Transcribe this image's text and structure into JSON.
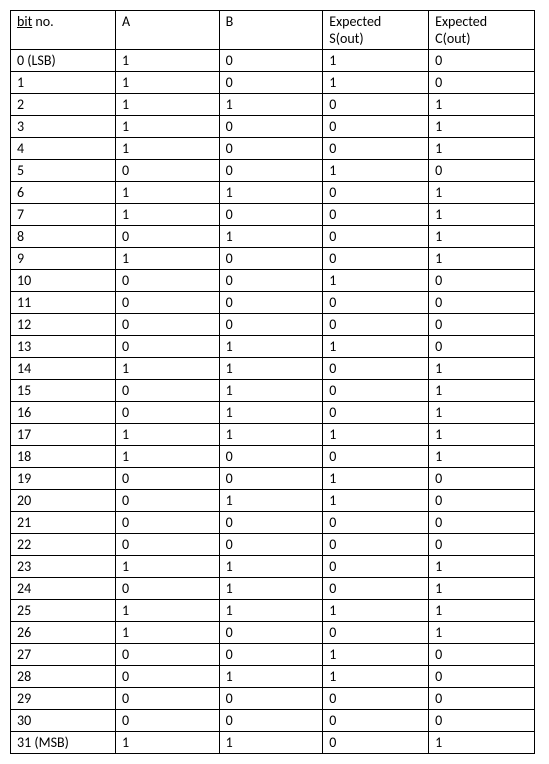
{
  "headers": {
    "bit_no_underline": "bit",
    "bit_no_rest": " no.",
    "a": "A",
    "b": "B",
    "sout_line1": "Expected",
    "sout_line2": "S(out)",
    "cout_line1": "Expected",
    "cout_line2": "C(out)"
  },
  "rows": [
    {
      "bit": "0 (LSB)",
      "a": "1",
      "b": "0",
      "s": "1",
      "c": "0"
    },
    {
      "bit": "1",
      "a": "1",
      "b": "0",
      "s": "1",
      "c": "0"
    },
    {
      "bit": "2",
      "a": "1",
      "b": "1",
      "s": "0",
      "c": "1"
    },
    {
      "bit": "3",
      "a": "1",
      "b": "0",
      "s": "0",
      "c": "1"
    },
    {
      "bit": "4",
      "a": "1",
      "b": "0",
      "s": "0",
      "c": "1"
    },
    {
      "bit": "5",
      "a": "0",
      "b": "0",
      "s": "1",
      "c": "0"
    },
    {
      "bit": "6",
      "a": "1",
      "b": "1",
      "s": "0",
      "c": "1"
    },
    {
      "bit": "7",
      "a": "1",
      "b": "0",
      "s": "0",
      "c": "1"
    },
    {
      "bit": "8",
      "a": "0",
      "b": "1",
      "s": "0",
      "c": "1"
    },
    {
      "bit": "9",
      "a": "1",
      "b": "0",
      "s": "0",
      "c": "1"
    },
    {
      "bit": "10",
      "a": "0",
      "b": "0",
      "s": "1",
      "c": "0"
    },
    {
      "bit": "11",
      "a": "0",
      "b": "0",
      "s": "0",
      "c": "0"
    },
    {
      "bit": "12",
      "a": "0",
      "b": "0",
      "s": "0",
      "c": "0"
    },
    {
      "bit": "13",
      "a": "0",
      "b": "1",
      "s": "1",
      "c": "0"
    },
    {
      "bit": "14",
      "a": "1",
      "b": "1",
      "s": "0",
      "c": "1"
    },
    {
      "bit": "15",
      "a": "0",
      "b": "1",
      "s": "0",
      "c": "1"
    },
    {
      "bit": "16",
      "a": "0",
      "b": "1",
      "s": "0",
      "c": "1"
    },
    {
      "bit": "17",
      "a": "1",
      "b": "1",
      "s": "1",
      "c": "1"
    },
    {
      "bit": "18",
      "a": "1",
      "b": "0",
      "s": "0",
      "c": "1"
    },
    {
      "bit": "19",
      "a": "0",
      "b": "0",
      "s": "1",
      "c": "0"
    },
    {
      "bit": "20",
      "a": "0",
      "b": "1",
      "s": "1",
      "c": "0"
    },
    {
      "bit": "21",
      "a": "0",
      "b": "0",
      "s": "0",
      "c": "0"
    },
    {
      "bit": "22",
      "a": "0",
      "b": "0",
      "s": "0",
      "c": "0"
    },
    {
      "bit": "23",
      "a": "1",
      "b": "1",
      "s": "0",
      "c": "1"
    },
    {
      "bit": "24",
      "a": "0",
      "b": "1",
      "s": "0",
      "c": "1"
    },
    {
      "bit": "25",
      "a": "1",
      "b": "1",
      "s": "1",
      "c": "1"
    },
    {
      "bit": "26",
      "a": "1",
      "b": "0",
      "s": "0",
      "c": "1"
    },
    {
      "bit": "27",
      "a": "0",
      "b": "0",
      "s": "1",
      "c": "0"
    },
    {
      "bit": "28",
      "a": "0",
      "b": "1",
      "s": "1",
      "c": "0"
    },
    {
      "bit": "29",
      "a": "0",
      "b": "0",
      "s": "0",
      "c": "0"
    },
    {
      "bit": "30",
      "a": "0",
      "b": "0",
      "s": "0",
      "c": "0"
    },
    {
      "bit": "31 (MSB)",
      "a": "1",
      "b": "1",
      "s": "0",
      "c": "1"
    }
  ]
}
